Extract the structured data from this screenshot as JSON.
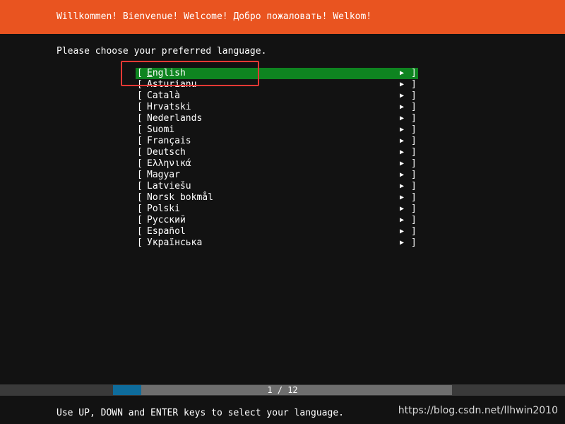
{
  "header": {
    "title": "Willkommen! Bienvenue! Welcome! Добро пожаловать! Welkom!",
    "bg_color": "#e95420"
  },
  "prompt": "Please choose your preferred language.",
  "languages": [
    {
      "label": "English",
      "selected": true
    },
    {
      "label": "Asturianu",
      "selected": false
    },
    {
      "label": "Català",
      "selected": false
    },
    {
      "label": "Hrvatski",
      "selected": false
    },
    {
      "label": "Nederlands",
      "selected": false
    },
    {
      "label": "Suomi",
      "selected": false
    },
    {
      "label": "Français",
      "selected": false
    },
    {
      "label": "Deutsch",
      "selected": false
    },
    {
      "label": "Ελληνικά",
      "selected": false
    },
    {
      "label": "Magyar",
      "selected": false
    },
    {
      "label": "Latviešu",
      "selected": false
    },
    {
      "label": "Norsk bokmål",
      "selected": false
    },
    {
      "label": "Polski",
      "selected": false
    },
    {
      "label": "Русский",
      "selected": false
    },
    {
      "label": "Español",
      "selected": false
    },
    {
      "label": "Українська",
      "selected": false
    }
  ],
  "list_glyphs": {
    "open": "[",
    "close": "]",
    "arrow": "▶"
  },
  "selected_color": "#0e8420",
  "progress": {
    "text": "1 / 12",
    "current": 1,
    "total": 12,
    "fill_color": "#0e6c9c"
  },
  "footer": "Use UP, DOWN and ENTER keys to select your language.",
  "watermark": "https://blog.csdn.net/llhwin2010",
  "annotation_color": "#e53935"
}
